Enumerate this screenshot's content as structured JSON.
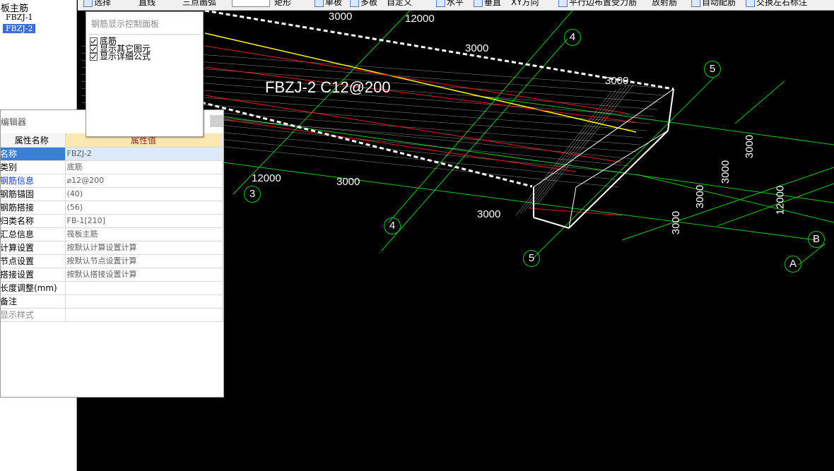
{
  "tree": {
    "root_label": "板主筋",
    "items": [
      "FBZJ-1",
      "FBZJ-2"
    ]
  },
  "toolbar": {
    "items": [
      "选择",
      "直线",
      "三点画弧",
      "矩形",
      "单板",
      "多板",
      "自定义",
      "水平",
      "垂直",
      "XY方向",
      "平行边布置受力筋",
      "放射筋",
      "自动配筋",
      "交换左右标注"
    ]
  },
  "control_panel": {
    "title": "钢筋显示控制面板",
    "options": [
      {
        "label": "底筋",
        "checked": true
      },
      {
        "label": "显示其它图元",
        "checked": true
      },
      {
        "label": "显示详细公式",
        "checked": true
      }
    ]
  },
  "properties": {
    "title": "编辑器",
    "col_name": "属性名称",
    "col_value": "属性值",
    "rows": [
      {
        "name": "名称",
        "value": "FBZJ-2"
      },
      {
        "name": "类别",
        "value": "底筋"
      },
      {
        "name": "钢筋信息",
        "value": "⌀12@200"
      },
      {
        "name": "钢筋锚固",
        "value": "(40)"
      },
      {
        "name": "钢筋搭接",
        "value": "(56)"
      },
      {
        "name": "归类名称",
        "value": "FB-1[210]"
      },
      {
        "name": "汇总信息",
        "value": "筏板主筋"
      },
      {
        "name": "计算设置",
        "value": "按默认计算设置计算"
      },
      {
        "name": "节点设置",
        "value": "按默认节点设置计算"
      },
      {
        "name": "搭接设置",
        "value": "按默认搭接设置计算"
      },
      {
        "name": "长度调整(mm)",
        "value": ""
      },
      {
        "name": "备注",
        "value": ""
      },
      {
        "name": "显示样式",
        "value": ""
      }
    ]
  },
  "drawing": {
    "rebar_label": "FBZJ-2  C12@200",
    "dims": [
      "3000",
      "12000",
      "3000",
      "3000",
      "12000",
      "3000",
      "3000",
      "3000",
      "3000",
      "3000",
      "3000",
      "12000",
      "3000"
    ],
    "axes": [
      "4",
      "5",
      "3",
      "4",
      "5",
      "B",
      "A"
    ]
  },
  "colors": {
    "canvas": "#000000",
    "grid": "#19c419",
    "rebar": "#ffffff",
    "yellow_line": "#ffff00",
    "red_line": "#e02020",
    "selection": "#3a7fd6"
  }
}
